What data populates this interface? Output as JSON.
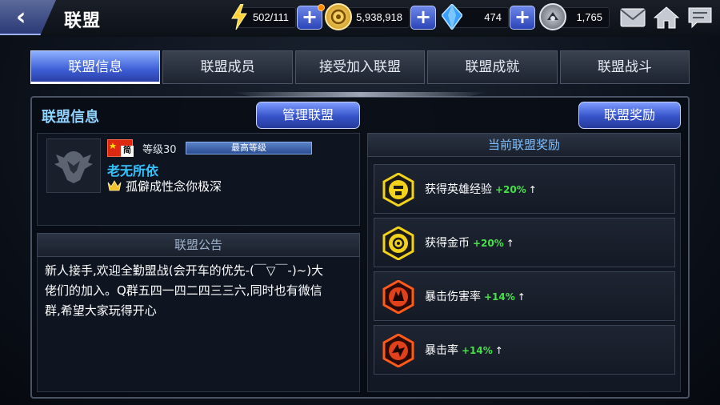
{
  "header": {
    "title": "联盟",
    "back_icon": "chevron-left-icon",
    "energy": "502/111",
    "gold": "5,938,918",
    "crystal": "474",
    "stamina": "1,765",
    "icons": [
      "energy-bolt-icon",
      "gold-coin-icon",
      "blue-crystal-icon",
      "stamina-icon",
      "mail-icon",
      "home-icon",
      "chat-icon"
    ]
  },
  "tabs": [
    {
      "label": "联盟信息",
      "active": true
    },
    {
      "label": "联盟成员",
      "active": false
    },
    {
      "label": "接受加入联盟",
      "active": false
    },
    {
      "label": "联盟成就",
      "active": false
    },
    {
      "label": "联盟战斗",
      "active": false
    }
  ],
  "info": {
    "section_title": "联盟信息",
    "manage_button": "管理联盟",
    "reward_button": "联盟奖励",
    "flag_badge": "简",
    "level": "等级30",
    "level_bar": "最高等级",
    "alliance_name": "老无所依",
    "leader_name": "孤僻成性念你极深"
  },
  "announcement": {
    "header": "联盟公告",
    "text": "新人接手,欢迎全勤盟战(会开车的优先-(￣▽￣-)~)大\n佬们的加入。Q群五四一四二四三三六,同时也有微信\n群,希望大家玩得开心"
  },
  "rewards": {
    "header": "当前联盟奖励",
    "items": [
      {
        "label": "获得英雄经验",
        "value": "+20%",
        "arrow": "↑",
        "icon": "hero-xp-icon"
      },
      {
        "label": "获得金币",
        "value": "+20%",
        "arrow": "↑",
        "icon": "gold-coin-icon"
      },
      {
        "label": "暴击伤害率",
        "value": "+14%",
        "arrow": "↑",
        "icon": "crit-damage-icon"
      },
      {
        "label": "暴击率",
        "value": "+14%",
        "arrow": "↑",
        "icon": "crit-rate-icon"
      }
    ]
  },
  "colors": {
    "accent_blue": "#3e5fd6",
    "name_cyan": "#35c3ff",
    "bonus_green": "#48e04a"
  }
}
